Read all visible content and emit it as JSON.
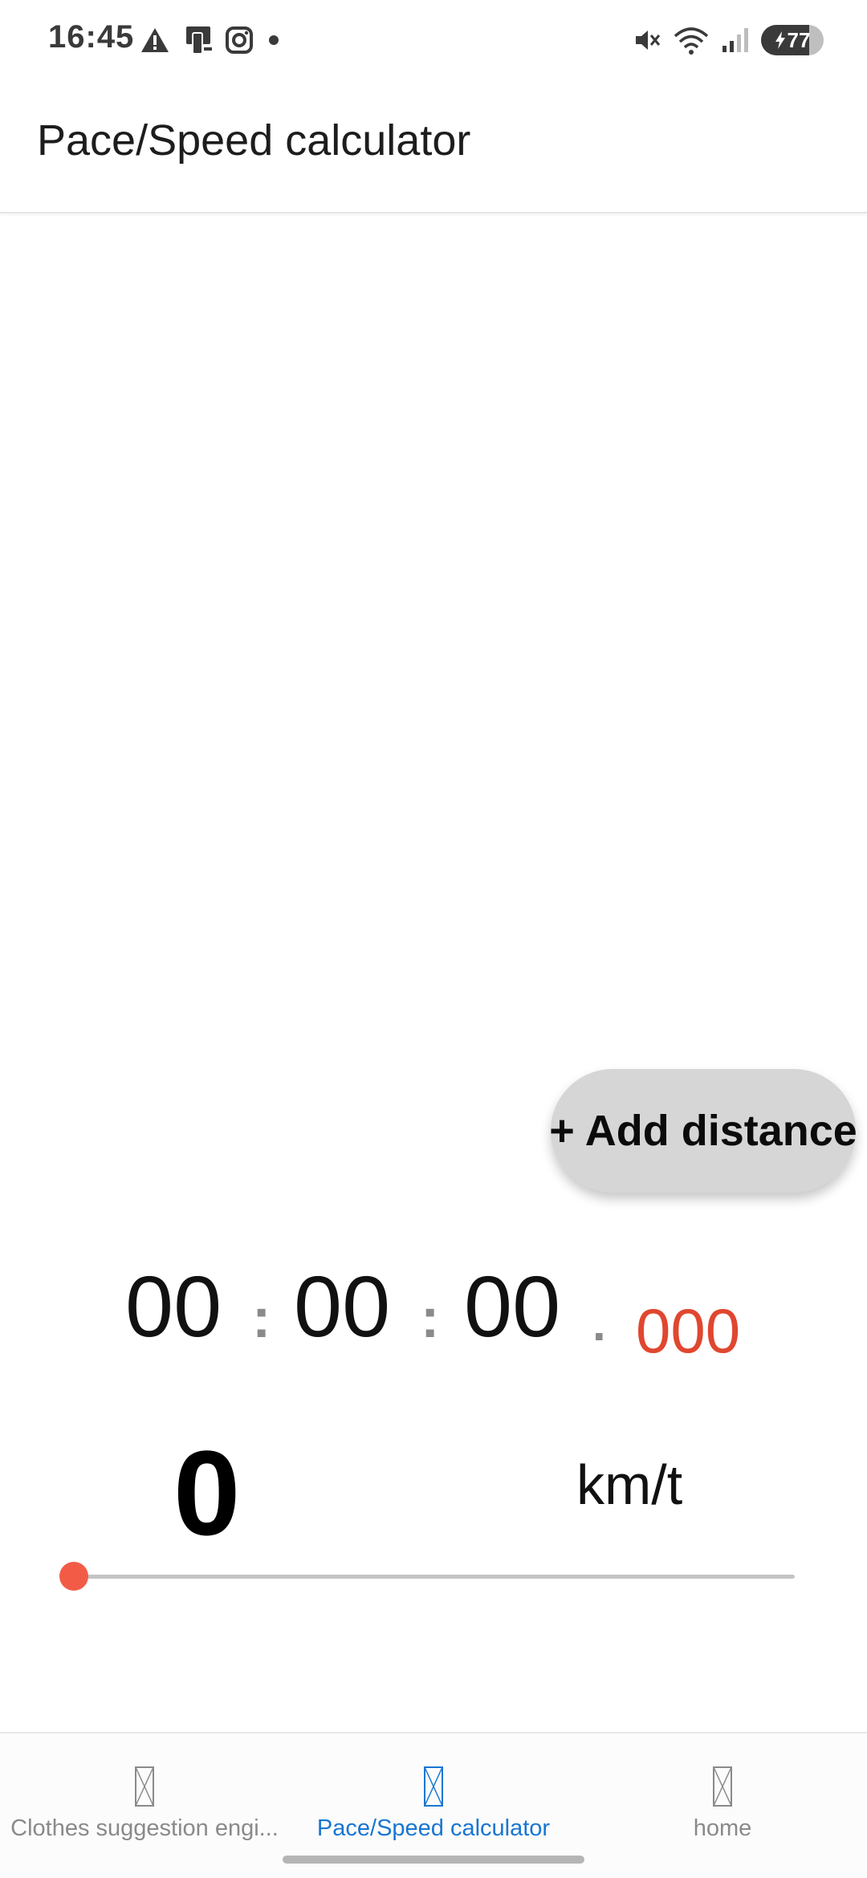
{
  "status_bar": {
    "time": "16:45",
    "left_icons": [
      "warning-icon",
      "cast-icon",
      "instagram-icon",
      "dot-icon"
    ],
    "right_icons": [
      "mute-icon",
      "wifi-icon",
      "signal-icon"
    ],
    "battery_percent": "77",
    "colors": {
      "icons": "#3a3a3a"
    }
  },
  "app_bar": {
    "title": "Pace/Speed calculator"
  },
  "fab": {
    "label": "+ Add distance"
  },
  "timer": {
    "hours": "00",
    "minutes": "00",
    "seconds": "00",
    "separator_colon": ":",
    "separator_dot": ".",
    "milliseconds": "000",
    "ms_color": "#e0472f"
  },
  "speed": {
    "value": "0",
    "unit": "km/t"
  },
  "slider": {
    "value_fraction": 0.0,
    "accent_color": "#f25c47"
  },
  "bottom_nav": {
    "items": [
      {
        "label": "Clothes suggestion engi...",
        "icon": "broken-image-icon",
        "active": false
      },
      {
        "label": "Pace/Speed calculator",
        "icon": "broken-image-icon",
        "active": true
      },
      {
        "label": "home",
        "icon": "broken-image-icon",
        "active": false
      }
    ],
    "active_color": "#1976d2",
    "inactive_color": "#8a8a8a"
  }
}
